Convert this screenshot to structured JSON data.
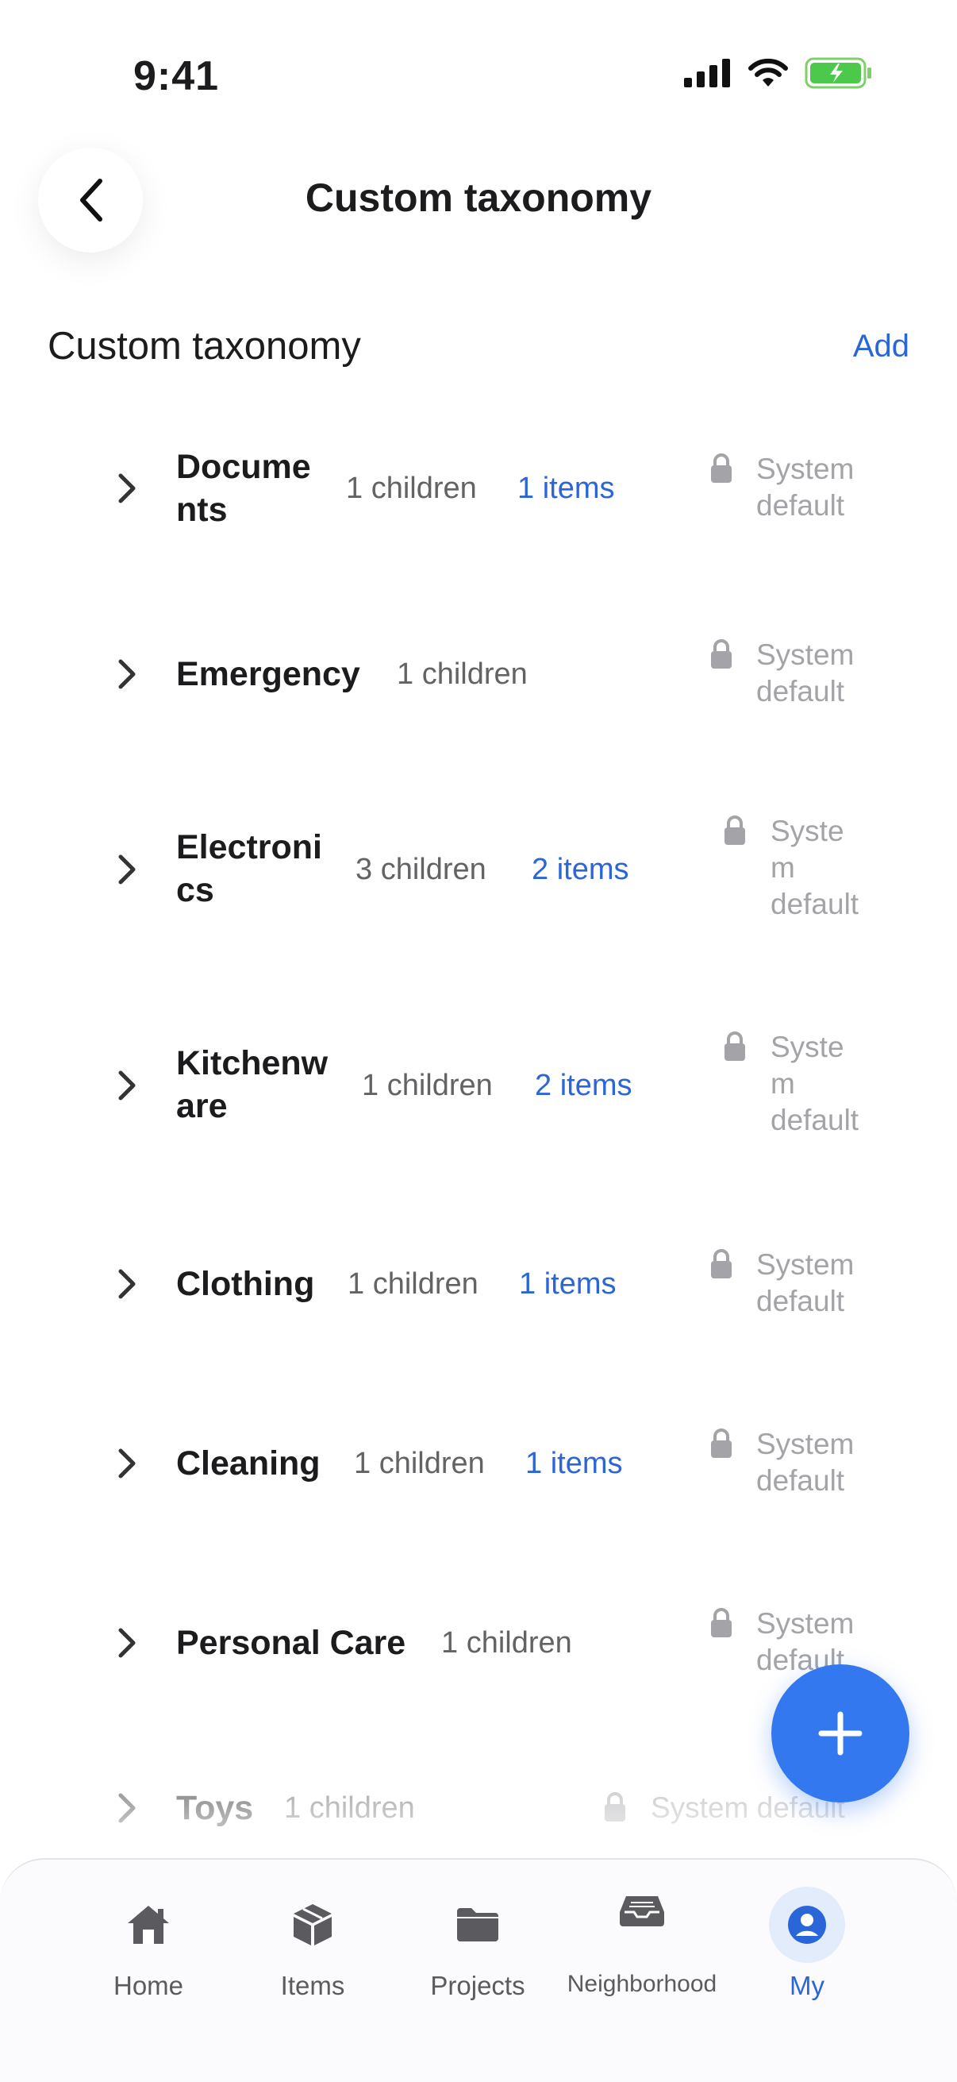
{
  "status_bar": {
    "time": "9:41"
  },
  "header": {
    "title": "Custom taxonomy"
  },
  "section": {
    "title": "Custom taxonomy",
    "add_label": "Add"
  },
  "rows": [
    {
      "name_line1": "Docume",
      "name_line2": "nts",
      "children": "1 children",
      "items": "1 items",
      "sys_line1": "System",
      "sys_line2": "default",
      "sys_line3": ""
    },
    {
      "name_line1": "Emergency",
      "name_line2": "",
      "children": "1 children",
      "items": "",
      "sys_line1": "System",
      "sys_line2": "default",
      "sys_line3": ""
    },
    {
      "name_line1": "Electroni",
      "name_line2": "cs",
      "children": "3 children",
      "items": "2 items",
      "sys_line1": "Syste",
      "sys_line2": "m",
      "sys_line3": "default"
    },
    {
      "name_line1": "Kitchenw",
      "name_line2": "are",
      "children": "1 children",
      "items": "2 items",
      "sys_line1": "Syste",
      "sys_line2": "m",
      "sys_line3": "default"
    },
    {
      "name_line1": "Clothing",
      "name_line2": "",
      "children": "1 children",
      "items": "1 items",
      "sys_line1": "System",
      "sys_line2": "default",
      "sys_line3": ""
    },
    {
      "name_line1": "Cleaning",
      "name_line2": "",
      "children": "1 children",
      "items": "1 items",
      "sys_line1": "System",
      "sys_line2": "default",
      "sys_line3": ""
    },
    {
      "name_line1": "Personal Care",
      "name_line2": "",
      "children": "1 children",
      "items": "",
      "sys_line1": "System",
      "sys_line2": "default",
      "sys_line3": ""
    },
    {
      "name_line1": "Toys",
      "name_line2": "",
      "children": "1 children",
      "items": "",
      "sys_line1": "System default",
      "sys_line2": "",
      "sys_line3": ""
    }
  ],
  "tabbar": {
    "tabs": [
      {
        "label": "Home",
        "icon": "home-icon"
      },
      {
        "label": "Items",
        "icon": "box-icon"
      },
      {
        "label": "Projects",
        "icon": "folder-icon"
      },
      {
        "label": "Neighborhood",
        "icon": "inbox-icon"
      },
      {
        "label": "My",
        "icon": "user-icon",
        "active": true
      }
    ]
  },
  "colors": {
    "accent": "#2b66d9",
    "fab": "#3478f0",
    "muted": "#a3a3a8"
  }
}
